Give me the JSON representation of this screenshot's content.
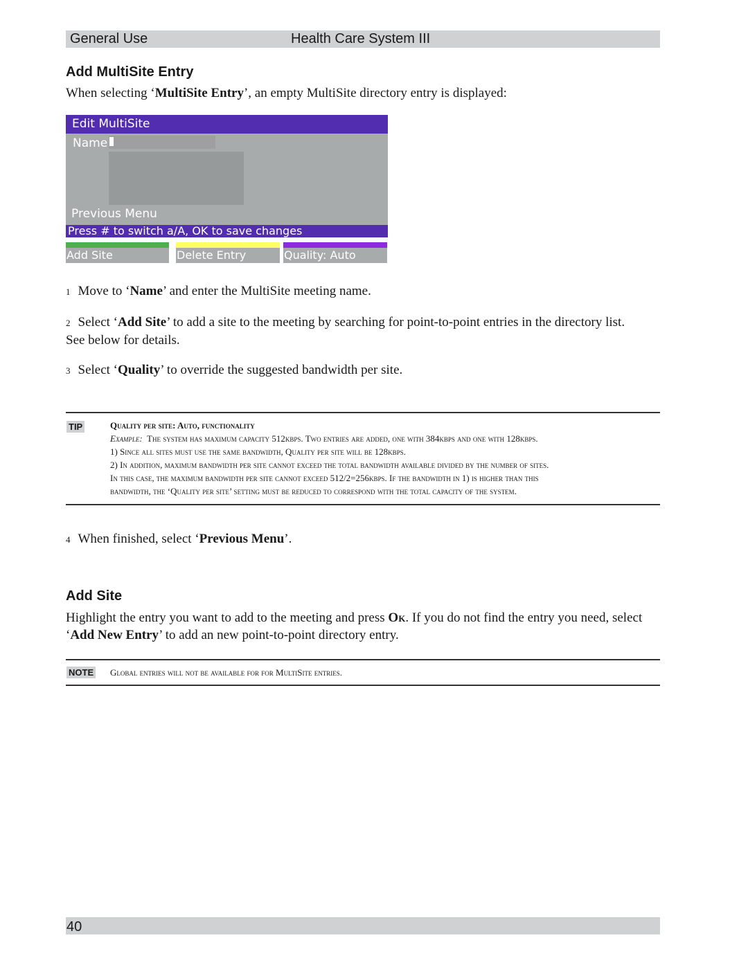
{
  "header": {
    "section": "General Use",
    "product": "Health Care System III"
  },
  "section1": {
    "title": "Add MultiSite Entry",
    "intro_pre": "When selecting ‘",
    "intro_bold": "MultiSite Entry",
    "intro_post": "’, an empty MultiSite directory entry is displayed:"
  },
  "osd": {
    "title": "Edit MultiSite",
    "name_label": "Name",
    "name_value": "",
    "previous_menu": "Previous Menu",
    "status": "Press # to switch a/A, OK to save changes",
    "buttons": [
      {
        "label": "Add Site",
        "color": "#4caf50"
      },
      {
        "label": "Delete Entry",
        "color": "#ffff66"
      },
      {
        "label": "Quality: Auto",
        "color": "#8a2be2"
      }
    ],
    "title_color": "#532db0"
  },
  "steps": [
    {
      "num": "1",
      "pre": "Move to ‘",
      "bold": "Name",
      "post": "’ and enter the MultiSite meeting name."
    },
    {
      "num": "2",
      "pre": "Select ‘",
      "bold": "Add Site",
      "post": "’ to add a site to the meeting by searching for point-to-point entries in the directory list.",
      "cont": "See below for details."
    },
    {
      "num": "3",
      "pre": "Select ‘",
      "bold": "Quality",
      "post": "’ to override the suggested bandwidth per site."
    },
    {
      "num": "4",
      "pre": "When finished, select ‘",
      "bold": "Previous Menu",
      "post": "’."
    }
  ],
  "tip": {
    "badge": "TIP",
    "title": "Quality per site: Auto, functionality",
    "example_label": "Example:",
    "lines": [
      "The system has maximum capacity 512kbps. Two entries are added, one with 384kbps and one with 128kbps.",
      "1) Since all sites must use the same bandwidth, Quality per site will be 128kbps.",
      "2) In addition, maximum bandwidth per site cannot exceed the total bandwidth available divided by the number of sites.",
      "In this case, the maximum bandwidth per site cannot exceed 512/2=256kbps. If the bandwidth in 1) is higher than this",
      "bandwidth, the ‘Quality per site’ setting must be reduced to correspond with the total capacity of the system."
    ]
  },
  "section2": {
    "title": "Add Site",
    "p1_pre": "Highlight the entry you want to add to the meeting and press ",
    "p1_bold": "Ok",
    "p1_post": ". If you do not find the entry you need, select",
    "p2_pre": "‘",
    "p2_bold": "Add New Entry",
    "p2_post": "’ to add an new point-to-point directory entry."
  },
  "note": {
    "badge": "NOTE",
    "text": "Global entries will not be available for for MultiSite entries."
  },
  "footer": {
    "page_number": "40"
  }
}
